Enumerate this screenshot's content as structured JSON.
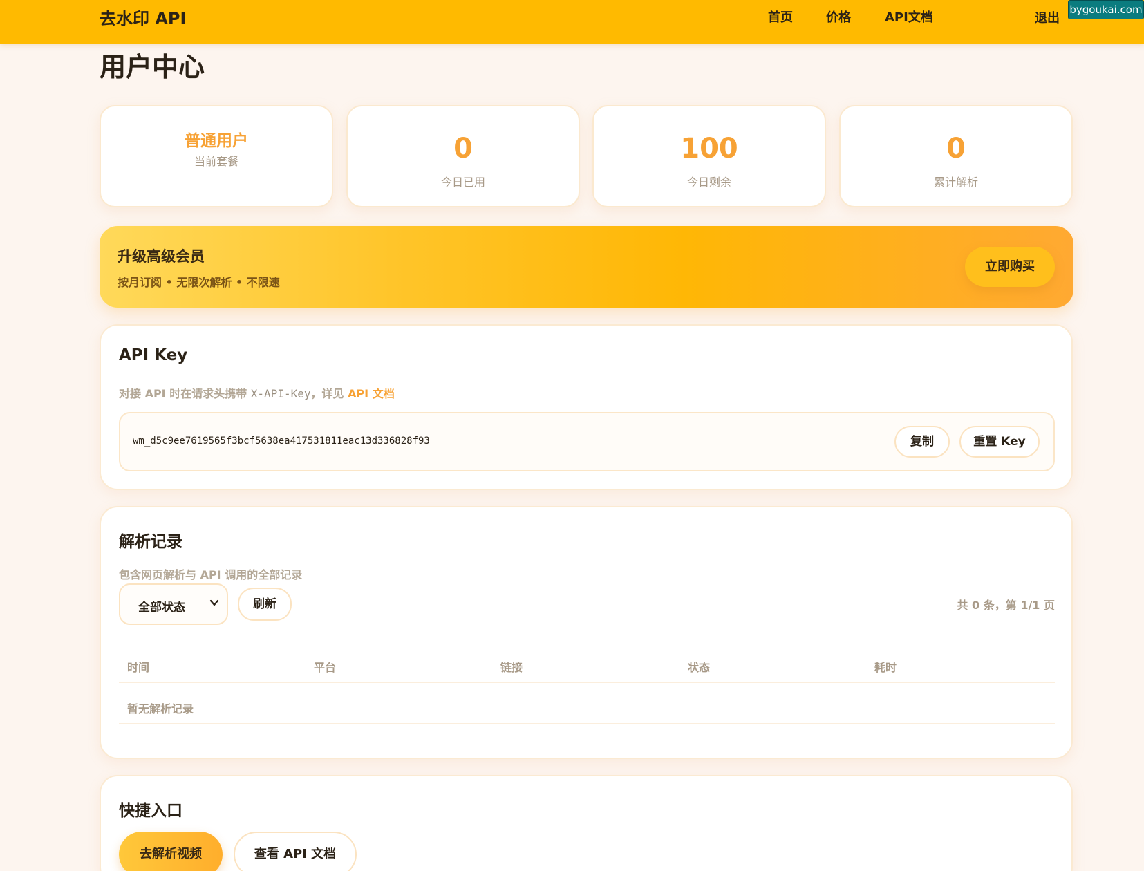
{
  "header": {
    "brand": "去水印 API",
    "nav": [
      "首页",
      "价格",
      "API文档"
    ],
    "logout": "退出",
    "watermark": "bygoukai.com"
  },
  "page": {
    "title": "用户中心"
  },
  "stats": {
    "plan": {
      "value": "普通用户",
      "label": "当前套餐"
    },
    "used_today": {
      "value": "0",
      "label": "今日已用"
    },
    "remaining_today": {
      "value": "100",
      "label": "今日剩余"
    },
    "total_parsed": {
      "value": "0",
      "label": "累计解析"
    }
  },
  "upgrade": {
    "title": "升级高级会员",
    "subtitle": "按月订阅 • 无限次解析 • 不限速",
    "button": "立即购买"
  },
  "api_key": {
    "title": "API Key",
    "desc_prefix": "对接 API 时在请求头携带 ",
    "desc_code": "X-API-Key",
    "desc_middle": "，详见 ",
    "desc_link": "API 文档",
    "key_value": "wm_d5c9ee7619565f3bcf5638ea417531811eac13d336828f93",
    "copy_button": "复制",
    "reset_button": "重置 Key"
  },
  "records": {
    "title": "解析记录",
    "desc": "包含网页解析与 API 调用的全部记录",
    "filter_selected": "全部状态",
    "refresh_button": "刷新",
    "count_text": "共 0 条，第 1/1 页",
    "columns": [
      "时间",
      "平台",
      "链接",
      "状态",
      "耗时"
    ],
    "empty_text": "暂无解析记录"
  },
  "quick": {
    "title": "快捷入口",
    "primary_button": "去解析视频",
    "secondary_button": "查看 API 文档"
  },
  "colors": {
    "topbar": "#ffba00",
    "accent": "#f7a235",
    "background": "#fdf5ef"
  }
}
